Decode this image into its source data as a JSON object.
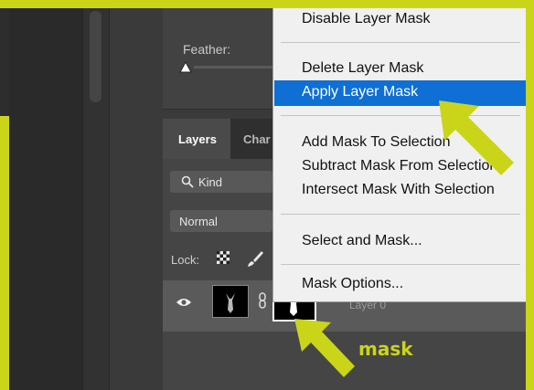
{
  "properties": {
    "feather_label": "Feather:"
  },
  "layers_panel": {
    "tabs": [
      {
        "label": "Layers"
      },
      {
        "label": "Char"
      }
    ],
    "filter": {
      "kind_label": "Kind"
    },
    "blend_mode": "Normal",
    "lock_label": "Lock:",
    "layer": {
      "name": "Layer 0"
    }
  },
  "context_menu": {
    "items": [
      {
        "label": "Disable Layer Mask"
      },
      {
        "label": "Delete Layer Mask"
      },
      {
        "label": "Apply Layer Mask",
        "highlighted": true
      },
      {
        "label": "Add Mask To Selection"
      },
      {
        "label": "Subtract Mask From Selection"
      },
      {
        "label": "Intersect Mask With Selection"
      },
      {
        "label": "Select and Mask..."
      },
      {
        "label": "Mask Options..."
      }
    ]
  },
  "annotation": {
    "mask_label": "mask",
    "accent_color": "#cad51a"
  },
  "colors": {
    "highlight": "#0f6fd4"
  }
}
